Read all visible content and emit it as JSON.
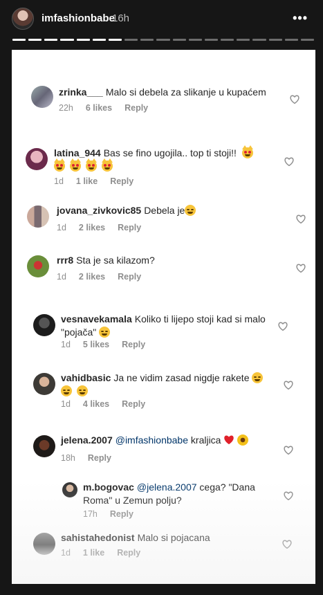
{
  "story": {
    "username": "imfashionbabe",
    "time": "16h",
    "more_icon": "more-horizontal-icon",
    "progress_segments_filled": 7,
    "progress_segments_total": 19
  },
  "comments": [
    {
      "username": "zrinka___",
      "text": "Malo si debela za slikanje u kupaćem",
      "time": "22h",
      "likes": "6 likes",
      "reply": "Reply"
    },
    {
      "username": "latina_944",
      "text": "Bas se fino ugojila.. top ti stoji!!",
      "time": "1d",
      "likes": "1 like",
      "reply": "Reply"
    },
    {
      "username": "jovana_zivkovic85",
      "text": "Debela je",
      "time": "1d",
      "likes": "2 likes",
      "reply": "Reply"
    },
    {
      "username": "rrr8",
      "text": "Sta je sa kilazom?",
      "time": "1d",
      "likes": "2 likes",
      "reply": "Reply"
    },
    {
      "username": "vesnavekamala",
      "text": "Koliko ti lijepo stoji kad si malo \"pojača\"",
      "time": "1d",
      "likes": "5 likes",
      "reply": "Reply"
    },
    {
      "username": "vahidbasic",
      "text": "Ja ne vidim zasad nigdje rakete",
      "time": "1d",
      "likes": "4 likes",
      "reply": "Reply"
    },
    {
      "username": "jelena.2007",
      "mention": "@imfashionbabe",
      "text": "kraljica",
      "time": "18h",
      "reply": "Reply"
    },
    {
      "username": "m.bogovac",
      "mention": "@jelena.2007",
      "text": "cega? \"Dana Roma\" u Zemun polju?",
      "time": "17h",
      "reply": "Reply"
    },
    {
      "username": "sahistahedonist",
      "text": "Malo si pojacana",
      "time": "1d",
      "likes": "1 like",
      "reply": "Reply"
    }
  ],
  "colors": {
    "background": "#161616",
    "card": "#ffffff",
    "text": "#262626",
    "meta": "#8e8e8e",
    "mention": "#003569"
  }
}
